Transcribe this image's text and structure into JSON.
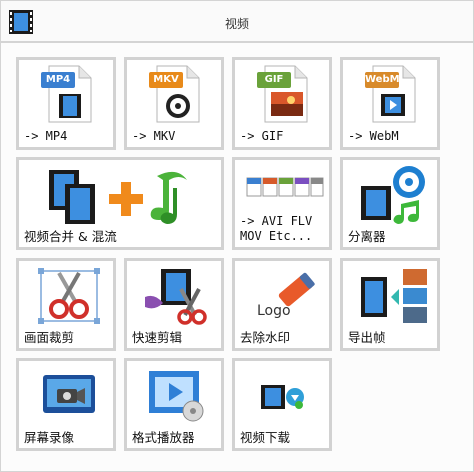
{
  "window": {
    "title": "视频"
  },
  "tiles": [
    {
      "label": "-> MP4",
      "icon": "mp4-file-icon",
      "badge": "MP4"
    },
    {
      "label": "-> MKV",
      "icon": "mkv-file-icon",
      "badge": "MKV"
    },
    {
      "label": "-> GIF",
      "icon": "gif-file-icon",
      "badge": "GIF"
    },
    {
      "label": "-> WebM",
      "icon": "webm-file-icon",
      "badge": "WebM"
    },
    {
      "label": "视频合并 & 混流",
      "icon": "merge-video-audio-icon"
    },
    {
      "label": "-> AVI FLV\nMOV Etc...",
      "icon": "multi-format-icon"
    },
    {
      "label": "分离器",
      "icon": "splitter-icon"
    },
    {
      "label": "画面裁剪",
      "icon": "crop-scissors-icon"
    },
    {
      "label": "快速剪辑",
      "icon": "quick-cut-icon"
    },
    {
      "label": "去除水印",
      "icon": "remove-watermark-icon",
      "logo_text": "Logo"
    },
    {
      "label": "导出帧",
      "icon": "export-frames-icon"
    },
    {
      "label": "屏幕录像",
      "icon": "screen-record-icon"
    },
    {
      "label": "格式播放器",
      "icon": "format-player-icon"
    },
    {
      "label": "视频下载",
      "icon": "video-download-icon"
    }
  ],
  "colors": {
    "tile_border": "#d2d2d2",
    "film_blue": "#2f7fd6"
  }
}
